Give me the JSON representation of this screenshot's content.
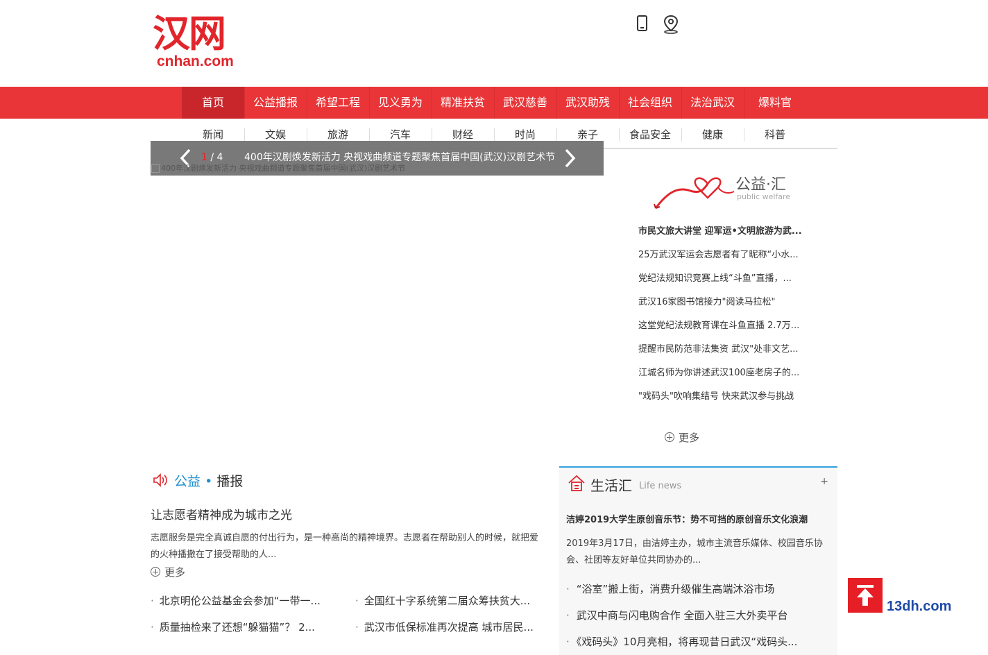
{
  "logo": {
    "cn": "汉网",
    "en": "cnhan.com"
  },
  "main_nav": [
    "首页",
    "公益播报",
    "希望工程",
    "见义勇为",
    "精准扶贫",
    "武汉慈善",
    "武汉助残",
    "社会组织",
    "法治武汉",
    "爆料官"
  ],
  "sub_nav": [
    "新闻",
    "文娱",
    "旅游",
    "汽车",
    "财经",
    "时尚",
    "亲子",
    "食品安全",
    "健康",
    "科普"
  ],
  "slider": {
    "current": "1",
    "total": "/ 4",
    "title": "400年汉剧焕发新活力 央视戏曲频道专题聚焦首届中国(武汉)汉剧艺术节",
    "alt_text": "400年汉剧焕发新活力 央视戏曲频道专题聚焦首届中国(武汉)汉剧艺术节"
  },
  "public_welfare": {
    "title": "公益·汇",
    "subtitle": "public welfare",
    "items": [
      "市民文旅大讲堂 迎军运•文明旅游为武...",
      "25万武汉军运会志愿者有了昵称“小水...",
      "党纪法规知识竞赛上线“斗鱼”直播，...",
      "武汉16家图书馆接力\"阅读马拉松\"",
      "这堂党纪法规教育课在斗鱼直播 2.7万...",
      "提醒市民防范非法集资 武汉\"处非文艺...",
      "江城名师为你讲述武汉100座老房子的...",
      "\"戏码头\"吹响集结号 快来武汉参与挑战"
    ],
    "more": "更多"
  },
  "broadcast": {
    "title_blue": "公益",
    "dot": "•",
    "title_rest": "播报",
    "headline": "让志愿者精神成为城市之光",
    "summary": "志愿服务是完全真诚自愿的付出行为，是一种高尚的精神境界。志愿者在帮助别人的时候，就把爱的火种播撒在了接受帮助的人...",
    "more": "更多",
    "news": [
      "北京明伦公益基金会参加“一带一...",
      "全国红十字系统第二届众筹扶贫大...",
      "质量抽检来了还想“躲猫猫”？ 2...",
      "武汉市低保标准再次提高 城市居民..."
    ]
  },
  "life": {
    "title": "生活汇",
    "subtitle": "Life news",
    "plus": "+",
    "headline": "洁婷2019大学生原创音乐节：势不可挡的原创音乐文化浪潮",
    "summary": "2019年3月17日，由洁婷主办，城市主流音乐媒体、校园音乐协会、社团等友好单位共同协办的...",
    "items": [
      "“浴室”搬上街，消费升级催生高端沐浴市场",
      "武汉中商与闪电购合作 全面入驻三大外卖平台",
      "《戏码头》10月亮相，将再现昔日武汉“戏码头..."
    ]
  },
  "watermark": {
    "text": "13dh.com"
  },
  "colors": {
    "brand_red": "#ea3538",
    "active_red": "#c8262b",
    "accent_blue": "#1e8fd0",
    "life_border": "#33a2dc"
  }
}
